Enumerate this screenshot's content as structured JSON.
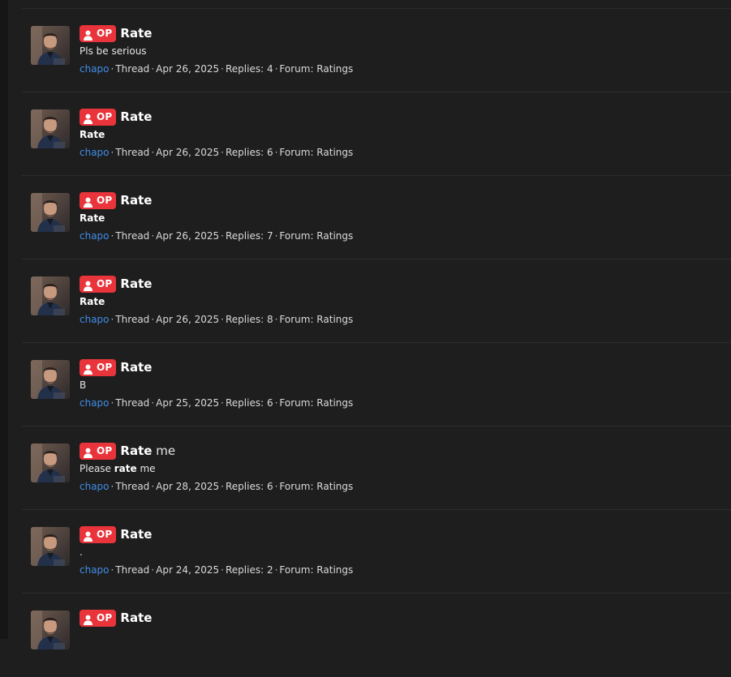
{
  "results": [
    {
      "badge": "OP",
      "title_bold": "Rate",
      "title_rest": "",
      "snippet_plain_before": "Pls be serious",
      "snippet_bold": "",
      "snippet_plain_after": "",
      "author": "chapo",
      "type": "Thread",
      "date": "Apr 26, 2025",
      "replies": "Replies: 4",
      "forum": "Forum: Ratings"
    },
    {
      "badge": "OP",
      "title_bold": "Rate",
      "title_rest": "",
      "snippet_plain_before": "",
      "snippet_bold": "Rate",
      "snippet_plain_after": "",
      "author": "chapo",
      "type": "Thread",
      "date": "Apr 26, 2025",
      "replies": "Replies: 6",
      "forum": "Forum: Ratings"
    },
    {
      "badge": "OP",
      "title_bold": "Rate",
      "title_rest": "",
      "snippet_plain_before": "",
      "snippet_bold": "Rate",
      "snippet_plain_after": "",
      "author": "chapo",
      "type": "Thread",
      "date": "Apr 26, 2025",
      "replies": "Replies: 7",
      "forum": "Forum: Ratings"
    },
    {
      "badge": "OP",
      "title_bold": "Rate",
      "title_rest": "",
      "snippet_plain_before": "",
      "snippet_bold": "Rate",
      "snippet_plain_after": "",
      "author": "chapo",
      "type": "Thread",
      "date": "Apr 26, 2025",
      "replies": "Replies: 8",
      "forum": "Forum: Ratings"
    },
    {
      "badge": "OP",
      "title_bold": "Rate",
      "title_rest": "",
      "snippet_plain_before": "B",
      "snippet_bold": "",
      "snippet_plain_after": "",
      "author": "chapo",
      "type": "Thread",
      "date": "Apr 25, 2025",
      "replies": "Replies: 6",
      "forum": "Forum: Ratings"
    },
    {
      "badge": "OP",
      "title_bold": "Rate",
      "title_rest": " me",
      "snippet_plain_before": "Please ",
      "snippet_bold": "rate",
      "snippet_plain_after": " me",
      "author": "chapo",
      "type": "Thread",
      "date": "Apr 28, 2025",
      "replies": "Replies: 6",
      "forum": "Forum: Ratings"
    },
    {
      "badge": "OP",
      "title_bold": "Rate",
      "title_rest": "",
      "snippet_plain_before": ".",
      "snippet_bold": "",
      "snippet_plain_after": "",
      "author": "chapo",
      "type": "Thread",
      "date": "Apr 24, 2025",
      "replies": "Replies: 2",
      "forum": "Forum: Ratings"
    },
    {
      "badge": "OP",
      "title_bold": "Rate",
      "title_rest": "",
      "snippet_plain_before": "",
      "snippet_bold": "",
      "snippet_plain_after": "",
      "author": "",
      "type": "",
      "date": "",
      "replies": "",
      "forum": ""
    }
  ],
  "meta_separator": "·",
  "icons": {
    "badge_icon": "user-icon",
    "avatar": "avatar-photo"
  },
  "colors": {
    "background": "#1e1e1e",
    "badge": "#e8343a",
    "author_link": "#3f8ee8"
  }
}
